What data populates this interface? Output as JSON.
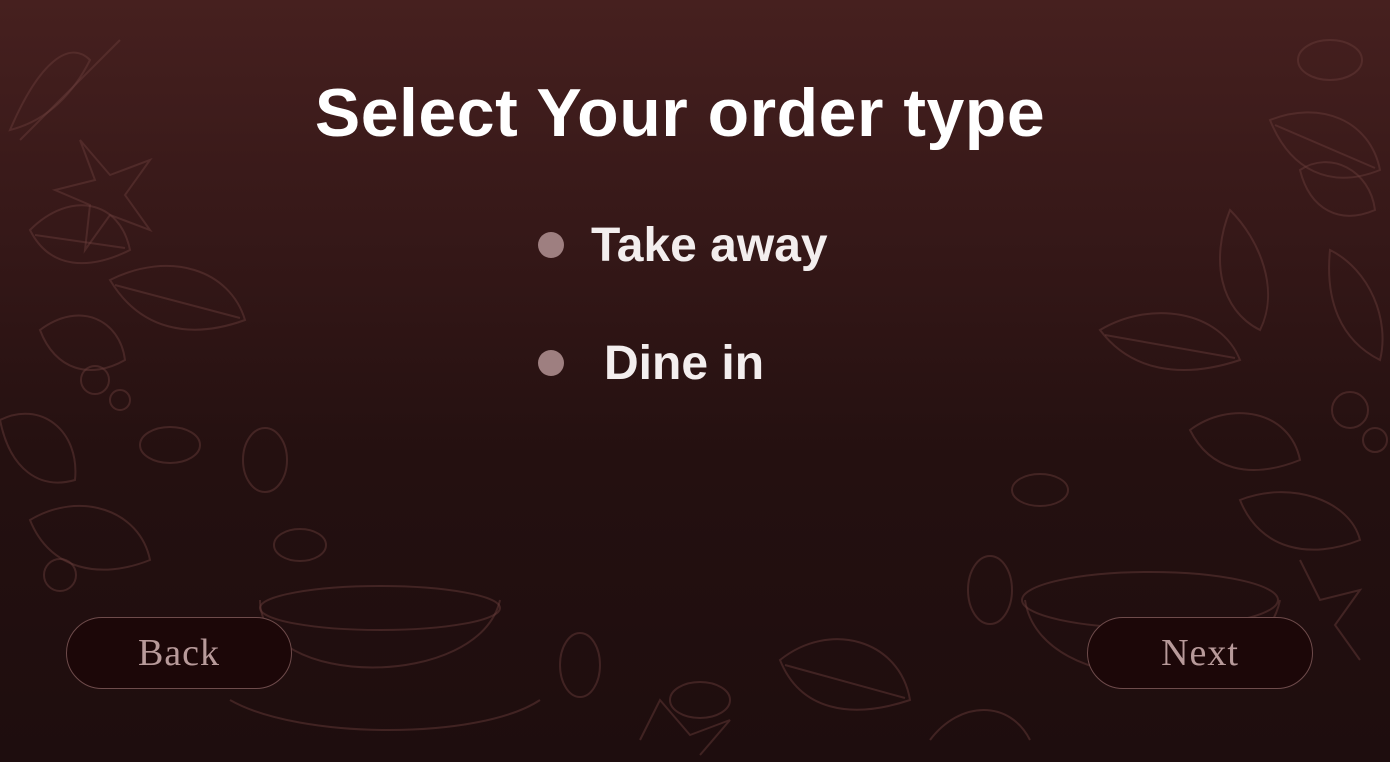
{
  "screen": {
    "title": "Select Your order type"
  },
  "options": [
    {
      "label": "Take away",
      "icon": "radio-dot-icon"
    },
    {
      "label": "Dine in",
      "icon": "radio-dot-icon"
    }
  ],
  "navigation": {
    "back_label": "Back",
    "next_label": "Next"
  },
  "colors": {
    "background_top": "#46201f",
    "background_bottom": "#1e0d0e",
    "radio_dot": "#9e7f80",
    "button_text": "#b89a9a",
    "button_border": "#6e4b4b"
  }
}
